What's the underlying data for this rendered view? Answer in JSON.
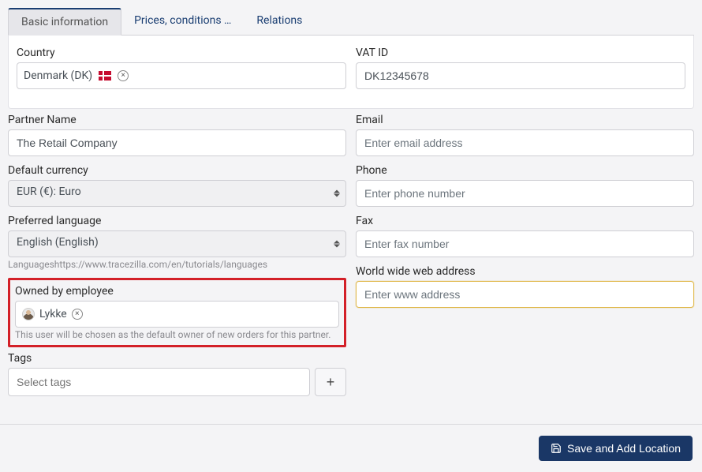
{
  "tabs": [
    {
      "label": "Basic information",
      "active": true
    },
    {
      "label": "Prices, conditions …",
      "active": false
    },
    {
      "label": "Relations",
      "active": false
    }
  ],
  "country": {
    "label": "Country",
    "value": "Denmark (DK)"
  },
  "vat": {
    "label": "VAT ID",
    "value": "DK12345678"
  },
  "partner": {
    "label": "Partner Name",
    "value": "The Retail Company"
  },
  "email": {
    "label": "Email",
    "placeholder": "Enter email address"
  },
  "currency": {
    "label": "Default currency",
    "value": "EUR (€): Euro"
  },
  "phone": {
    "label": "Phone",
    "placeholder": "Enter phone number"
  },
  "language": {
    "label": "Preferred language",
    "value": "English (English)",
    "helper": "Languageshttps://www.tracezilla.com/en/tutorials/languages"
  },
  "fax": {
    "label": "Fax",
    "placeholder": "Enter fax number"
  },
  "www": {
    "label": "World wide web address",
    "placeholder": "Enter www address"
  },
  "owner": {
    "label": "Owned by employee",
    "value": "Lykke",
    "helper": "This user will be chosen as the default owner of new orders for this partner."
  },
  "tags": {
    "label": "Tags",
    "placeholder": "Select tags"
  },
  "footer": {
    "save": "Save and Add Location"
  }
}
